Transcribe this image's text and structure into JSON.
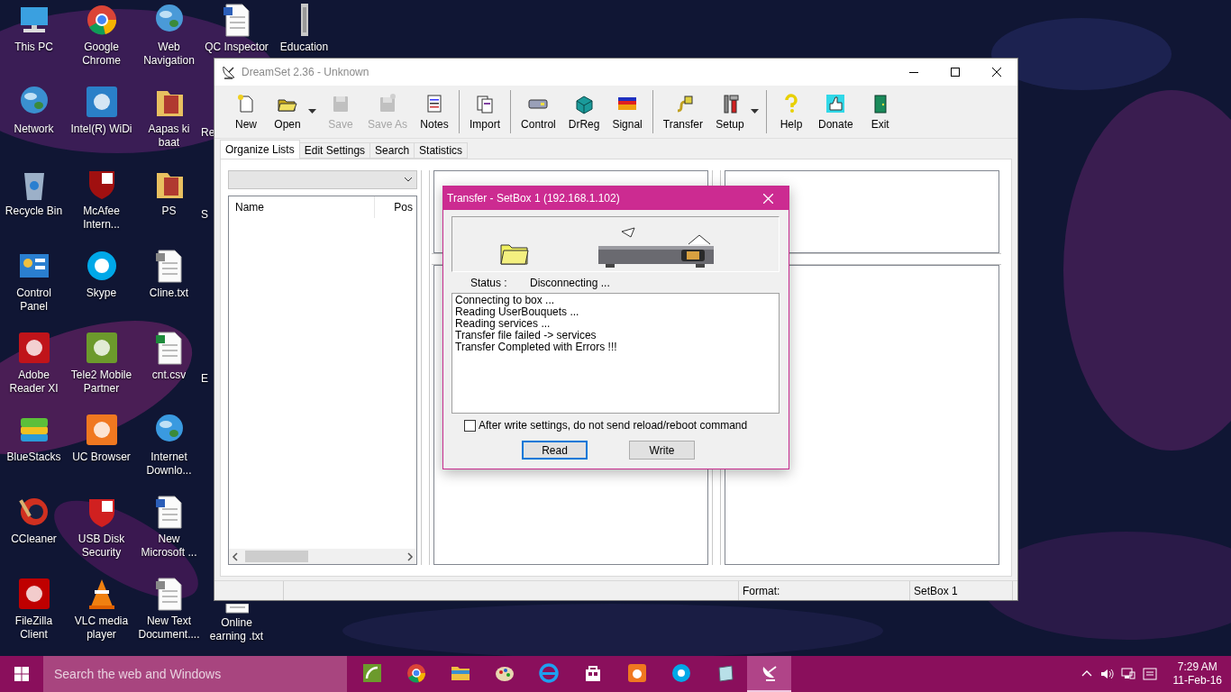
{
  "desktop": {
    "columns": [
      [
        {
          "label": "This PC",
          "kind": "icon"
        },
        {
          "label": "Network",
          "kind": "icon"
        },
        {
          "label": "Recycle Bin",
          "kind": "icon"
        },
        {
          "label": "Control Panel",
          "kind": "icon"
        },
        {
          "label": "Adobe Reader XI",
          "kind": "icon"
        },
        {
          "label": "BlueStacks",
          "kind": "icon"
        },
        {
          "label": "CCleaner",
          "kind": "icon"
        },
        {
          "label": "FileZilla Client",
          "kind": "icon"
        }
      ],
      [
        {
          "label": "Google Chrome",
          "kind": "icon"
        },
        {
          "label": "Intel(R) WiDi",
          "kind": "icon"
        },
        {
          "label": "McAfee Intern...",
          "kind": "icon"
        },
        {
          "label": "Skype",
          "kind": "icon"
        },
        {
          "label": "Tele2 Mobile Partner",
          "kind": "icon"
        },
        {
          "label": "UC Browser",
          "kind": "icon"
        },
        {
          "label": "USB Disk Security",
          "kind": "icon"
        },
        {
          "label": "VLC media player",
          "kind": "icon"
        }
      ],
      [
        {
          "label": "Web Navigation",
          "kind": "icon"
        },
        {
          "label": "Aapas ki baat",
          "kind": "icon"
        },
        {
          "label": "PS",
          "kind": "icon"
        },
        {
          "label": "Cline.txt",
          "kind": "icon"
        },
        {
          "label": "cnt.csv",
          "kind": "icon"
        },
        {
          "label": "Internet Downlo...",
          "kind": "icon"
        },
        {
          "label": "New Microsoft ...",
          "kind": "icon"
        },
        {
          "label": "New Text Document....",
          "kind": "icon"
        }
      ],
      [
        {
          "label": "QC Inspector",
          "kind": "icon"
        },
        {
          "label": "Re",
          "kind": "cut"
        },
        {
          "label": "S",
          "kind": "cut"
        },
        {
          "label": "E",
          "kind": "cut"
        },
        {
          "label": "Online earning .txt",
          "kind": "peek"
        }
      ],
      [
        {
          "label": "Education",
          "kind": "icon"
        }
      ]
    ]
  },
  "window": {
    "title": "DreamSet 2.36 - Unknown",
    "toolbar": [
      [
        {
          "label": "New",
          "disabled": false,
          "dropdown": false
        },
        {
          "label": "Open",
          "disabled": false,
          "dropdown": true
        },
        {
          "label": "Save",
          "disabled": true,
          "dropdown": false
        },
        {
          "label": "Save As",
          "disabled": true,
          "dropdown": false
        },
        {
          "label": "Notes",
          "disabled": false,
          "dropdown": false
        }
      ],
      [
        {
          "label": "Import",
          "disabled": false,
          "dropdown": false
        }
      ],
      [
        {
          "label": "Control",
          "disabled": false,
          "dropdown": false
        },
        {
          "label": "DrReg",
          "disabled": false,
          "dropdown": false
        },
        {
          "label": "Signal",
          "disabled": false,
          "dropdown": false
        }
      ],
      [
        {
          "label": "Transfer",
          "disabled": false,
          "dropdown": false
        },
        {
          "label": "Setup",
          "disabled": false,
          "dropdown": true
        }
      ],
      [
        {
          "label": "Help",
          "disabled": false,
          "dropdown": false
        },
        {
          "label": "Donate",
          "disabled": false,
          "dropdown": false
        },
        {
          "label": "Exit",
          "disabled": false,
          "dropdown": false
        }
      ]
    ],
    "tabs": [
      {
        "label": "Organize Lists",
        "selected": true
      },
      {
        "label": "Edit Settings",
        "selected": false
      },
      {
        "label": "Search",
        "selected": false
      },
      {
        "label": "Statistics",
        "selected": false
      }
    ],
    "list": {
      "columns": [
        "Name",
        "Pos"
      ]
    },
    "status_bar": [
      "Format:",
      "SetBox 1"
    ]
  },
  "dialog": {
    "title": "Transfer - SetBox 1 (192.168.1.102)",
    "status_label": "Status :",
    "status_value": "Disconnecting ...",
    "log": [
      "Connecting to box ...",
      "Reading UserBouquets ...",
      "Reading services ...",
      "Transfer file failed -> services",
      "Transfer Completed with Errors !!!"
    ],
    "checkbox": {
      "label": "After write settings, do not send reload/reboot command",
      "checked": false
    },
    "buttons": [
      {
        "label": "Read",
        "selected": true
      },
      {
        "label": "Write",
        "selected": false
      }
    ]
  },
  "taskbar": {
    "search": {
      "placeholder": "Search the web and Windows"
    },
    "apps": [
      {
        "selected": false
      },
      {
        "selected": false
      },
      {
        "selected": false
      },
      {
        "selected": false
      },
      {
        "selected": false
      },
      {
        "selected": false
      },
      {
        "selected": false
      },
      {
        "selected": false
      },
      {
        "selected": false
      },
      {
        "selected": true
      }
    ],
    "time": "7:29 AM",
    "date": "11-Feb-16"
  }
}
